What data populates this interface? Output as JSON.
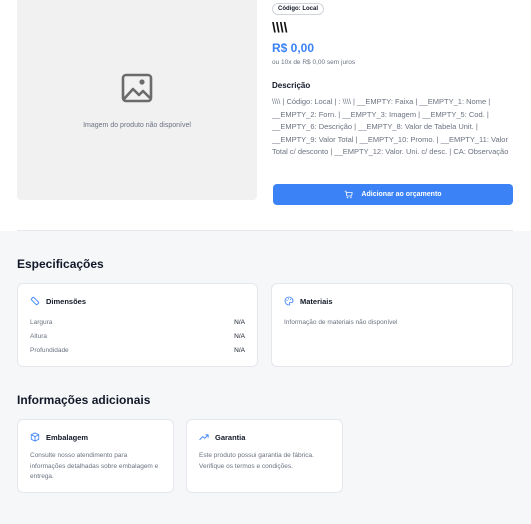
{
  "product": {
    "image_caption": "Imagem do produto não disponível",
    "code_badge": "Código: Local",
    "title": "\\\\\\\\",
    "price": "R$ 0,00",
    "installments": "ou 10x de R$ 0,00 sem juros",
    "description_heading": "Descrição",
    "description": "\\\\\\\\ | Código: Local | : \\\\\\\\ | __EMPTY: Faixa | __EMPTY_1: Nome | __EMPTY_2: Forn. | __EMPTY_3: Imagem | __EMPTY_5: Cod. | __EMPTY_6: Descrição | __EMPTY_8: Valor de Tabela Unit. | __EMPTY_9: Valor Total | __EMPTY_10: Promo. | __EMPTY_11: Valor Total c/ desconto | __EMPTY_12: Valor. Uni. c/ desc. | CA: Observação",
    "add_button": "Adicionar ao orçamento"
  },
  "specs": {
    "title": "Especificações",
    "dimensions": {
      "title": "Dimensões",
      "rows": [
        {
          "label": "Largura",
          "value": "N/A"
        },
        {
          "label": "Altura",
          "value": "N/A"
        },
        {
          "label": "Profundidade",
          "value": "N/A"
        }
      ]
    },
    "materials": {
      "title": "Materiais",
      "text": "Informação de materiais não disponível"
    }
  },
  "additional": {
    "title": "Informações adicionais",
    "packaging": {
      "title": "Embalagem",
      "text": "Consulte nosso atendimento para informações detalhadas sobre embalagem e entrega."
    },
    "warranty": {
      "title": "Garantia",
      "text": "Este produto possui garantia de fábrica. Verifique os termos e condições."
    }
  },
  "colors": {
    "accent": "#3b82f6",
    "page_bg": "#f6f7f9",
    "muted_text": "#6b7280"
  },
  "icons": [
    "image-placeholder-icon",
    "cart-icon",
    "ruler-icon",
    "palette-icon",
    "box-icon",
    "trending-up-icon"
  ]
}
